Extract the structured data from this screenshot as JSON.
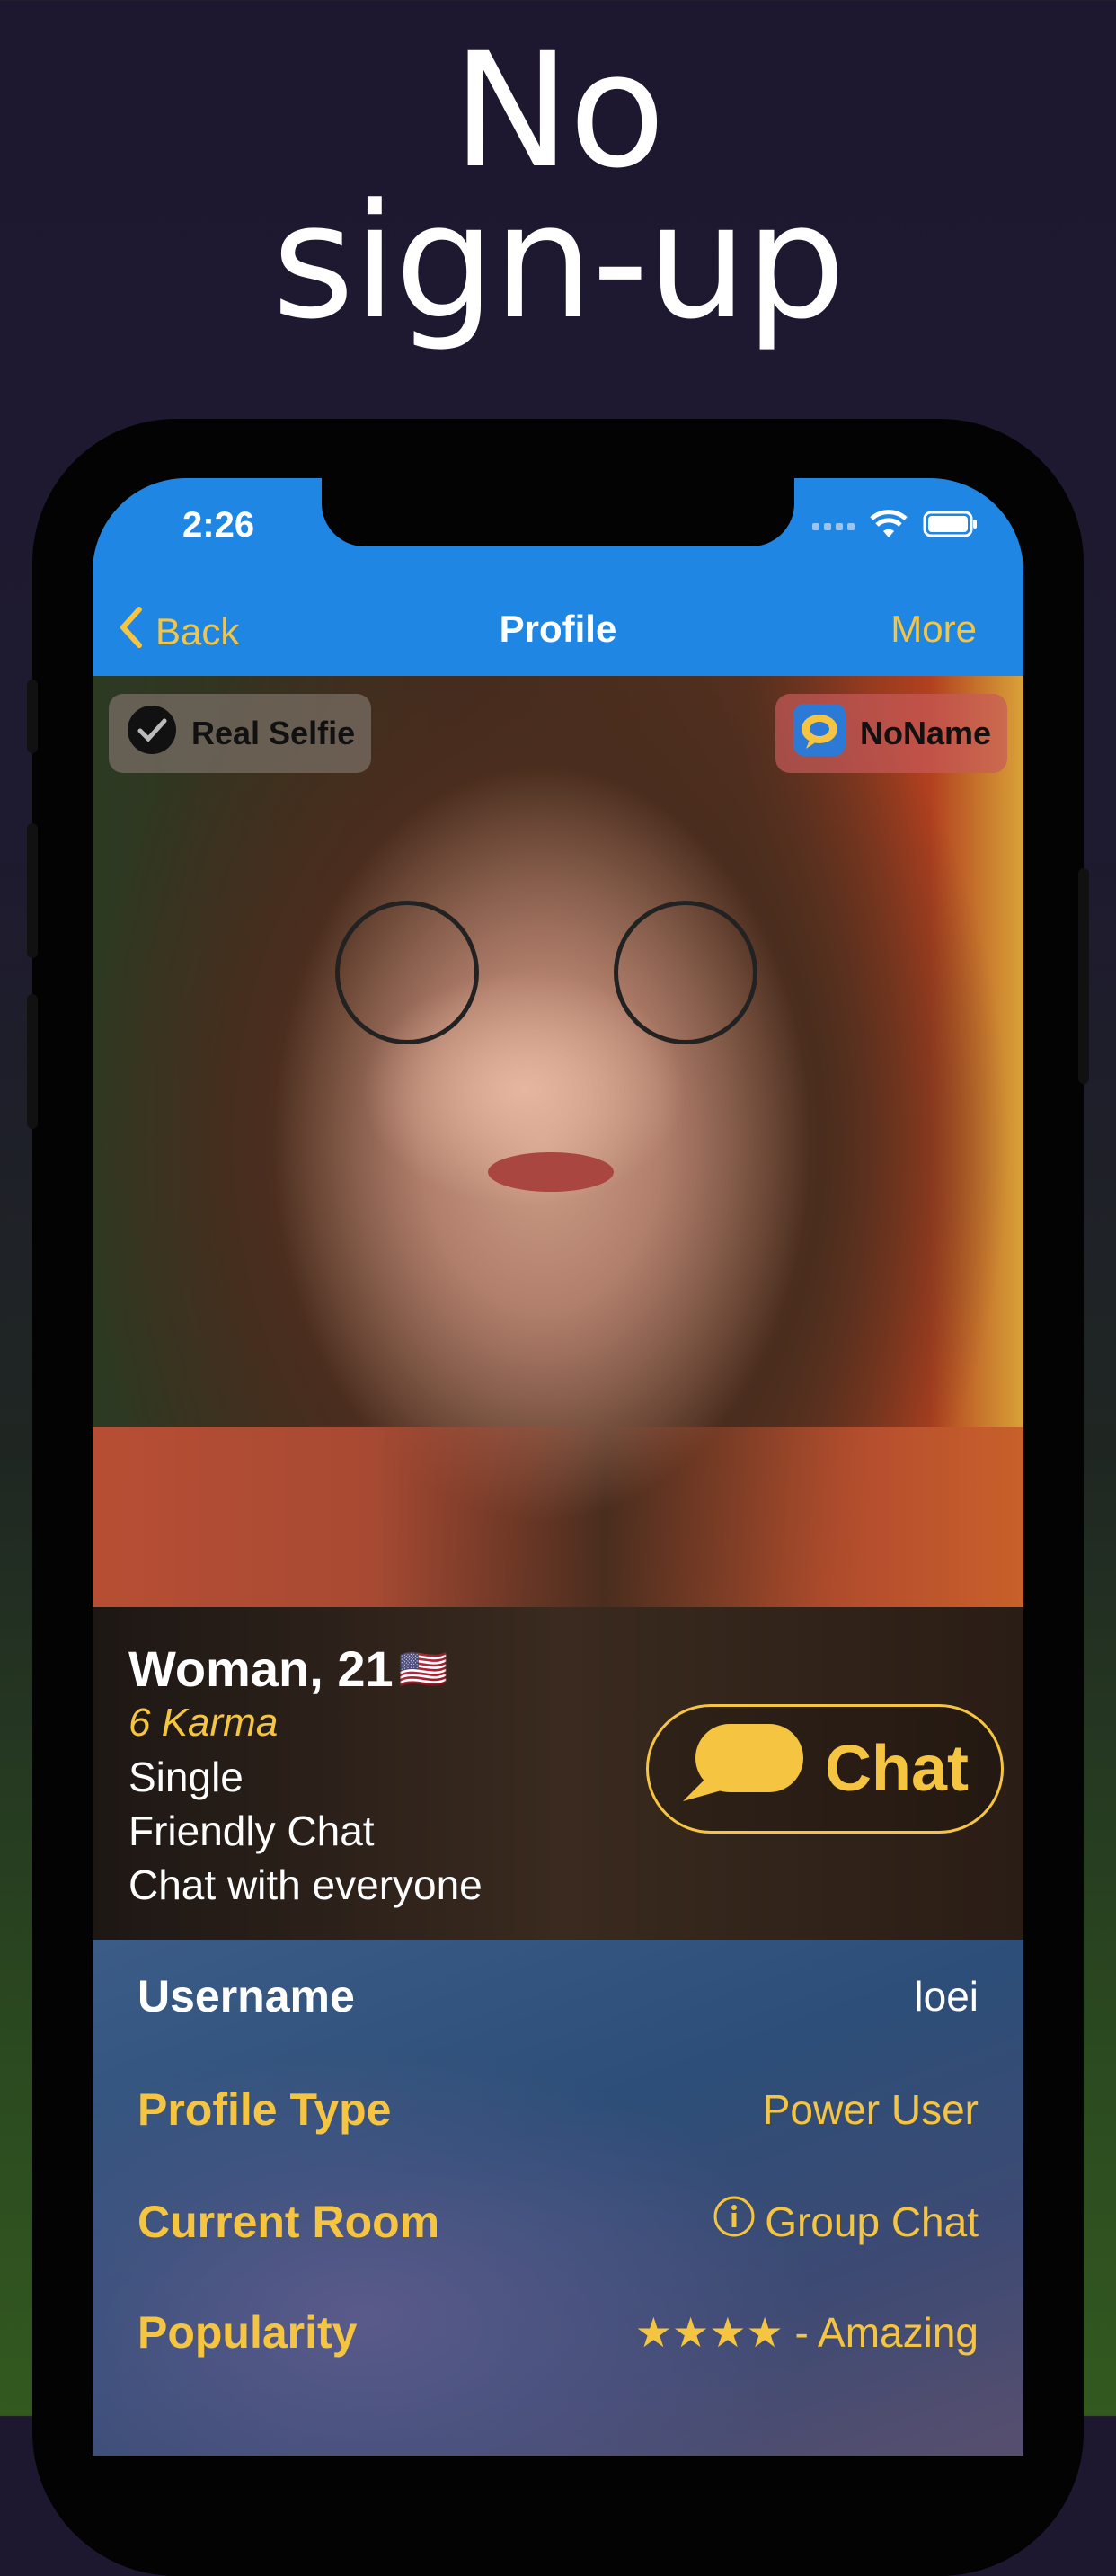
{
  "hero": {
    "title": "No\nsign-up"
  },
  "status_bar": {
    "time": "2:26"
  },
  "nav": {
    "back_label": "Back",
    "title": "Profile",
    "more_label": "More"
  },
  "badges": {
    "selfie_label": "Real Selfie",
    "noname_label": "NoName"
  },
  "profile": {
    "title": "Woman, 21",
    "flag": "🇺🇸",
    "karma": "6 Karma",
    "lines": [
      "Single",
      "Friendly Chat",
      "Chat with everyone"
    ],
    "chat_label": "Chat"
  },
  "details": [
    {
      "label": "Username",
      "value": "loei",
      "label_color": "#ffffff",
      "value_color": "#ffffff"
    },
    {
      "label": "Profile Type",
      "value": "Power User",
      "label_color": "#f5c542",
      "value_color": "#f5c542"
    },
    {
      "label": "Current Room",
      "value": "Group Chat",
      "label_color": "#f5c542",
      "value_color": "#f5c542",
      "icon": "info-icon"
    },
    {
      "label": "Popularity",
      "value": "★★★★ - Amazing",
      "label_color": "#f5c542",
      "value_color": "#f5c542",
      "rating_stars": 4
    }
  ],
  "colors": {
    "accent": "#f5c542",
    "nav_bar": "#1f86e4"
  }
}
